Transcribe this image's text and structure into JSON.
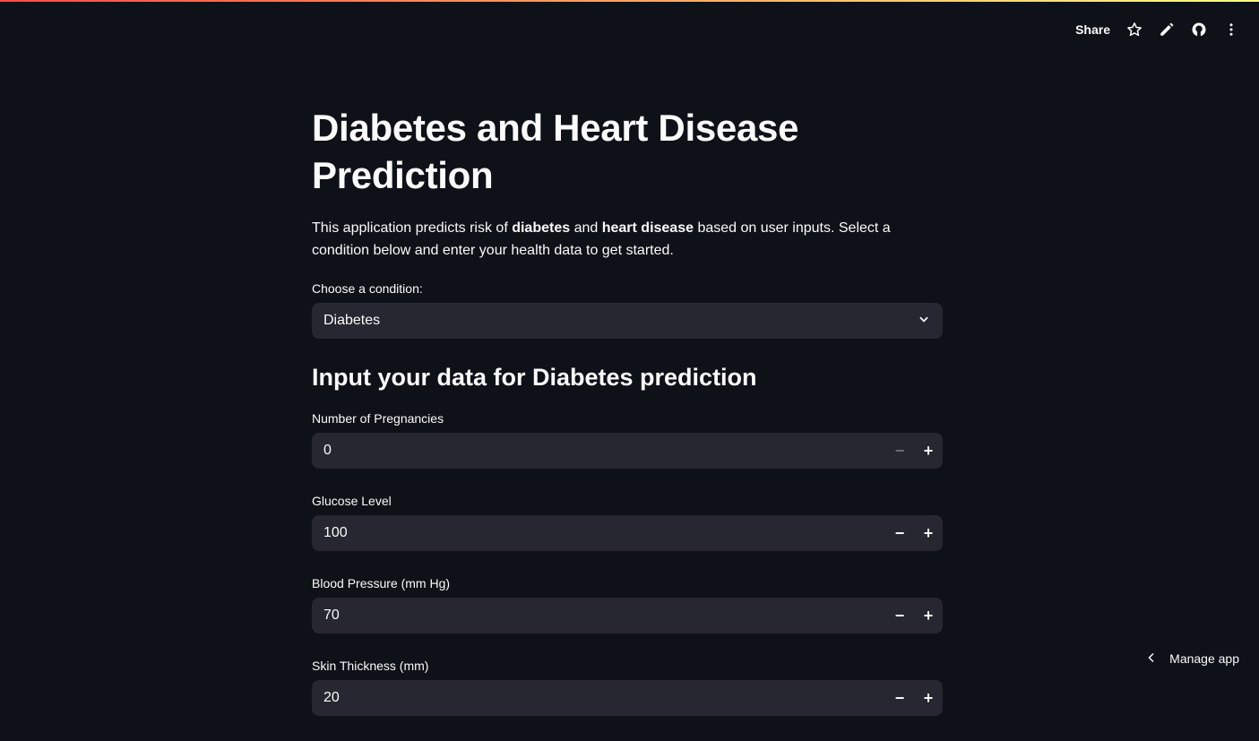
{
  "header": {
    "share_label": "Share",
    "icons": [
      "star-icon",
      "pencil-icon",
      "github-icon",
      "more-vertical-icon"
    ]
  },
  "title": "Diabetes and Heart Disease Prediction",
  "intro": {
    "pre": "This application predicts risk of ",
    "b1": "diabetes",
    "mid": " and ",
    "b2": "heart disease",
    "post": " based on user inputs. Select a condition below and enter your health data to get started."
  },
  "condition": {
    "label": "Choose a condition:",
    "value": "Diabetes"
  },
  "section_title": "Input your data for Diabetes prediction",
  "fields": [
    {
      "label": "Number of Pregnancies",
      "value": "0"
    },
    {
      "label": "Glucose Level",
      "value": "100"
    },
    {
      "label": "Blood Pressure (mm Hg)",
      "value": "70"
    },
    {
      "label": "Skin Thickness (mm)",
      "value": "20"
    }
  ],
  "footer": {
    "manage_label": "Manage app"
  }
}
